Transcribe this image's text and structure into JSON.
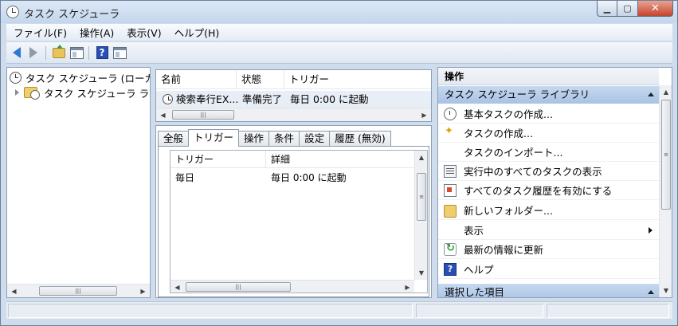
{
  "window": {
    "title": "タスク スケジューラ",
    "min_glyph": "▁",
    "max_glyph": "▢",
    "close_glyph": "✕"
  },
  "menu": [
    "ファイル(F)",
    "操作(A)",
    "表示(V)",
    "ヘルプ(H)"
  ],
  "tree": {
    "root_label": "タスク スケジューラ (ローカ",
    "child_label": "タスク スケジューラ ライ"
  },
  "task_list": {
    "columns": [
      "名前",
      "状態",
      "トリガー"
    ],
    "rows": [
      {
        "name": "検索奉行EX...",
        "status": "準備完了",
        "trigger": "毎日 0:00 に起動"
      }
    ]
  },
  "tabs": [
    "全般",
    "トリガー",
    "操作",
    "条件",
    "設定",
    "履歴 (無効)"
  ],
  "trigger_list": {
    "columns": [
      "トリガー",
      "詳細"
    ],
    "rows": [
      {
        "trigger": "毎日",
        "detail": "毎日 0:00 に起動"
      }
    ]
  },
  "actions": {
    "title": "操作",
    "library_section": "タスク スケジューラ ライブラリ",
    "items": [
      {
        "label": "基本タスクの作成...",
        "icon": "clock-icon"
      },
      {
        "label": "タスクの作成...",
        "icon": "star-icon"
      },
      {
        "label": "タスクのインポート...",
        "icon": ""
      },
      {
        "label": "実行中のすべてのタスクの表示",
        "icon": "list-icon"
      },
      {
        "label": "すべてのタスク履歴を有効にする",
        "icon": "history-icon"
      },
      {
        "label": "新しいフォルダー...",
        "icon": "folder-icon"
      },
      {
        "label": "表示",
        "icon": "",
        "submenu": true
      },
      {
        "label": "最新の情報に更新",
        "icon": "refresh-icon"
      },
      {
        "label": "ヘルプ",
        "icon": "help-icon"
      }
    ],
    "selected_section": "選択した項目"
  },
  "scroll": {
    "left_arrow": "◀",
    "right_arrow": "▶",
    "up_arrow": "▲",
    "down_arrow": "▼",
    "grip": "|||",
    "vgrip": "≡"
  },
  "toolbar": {
    "help_glyph": "?"
  }
}
